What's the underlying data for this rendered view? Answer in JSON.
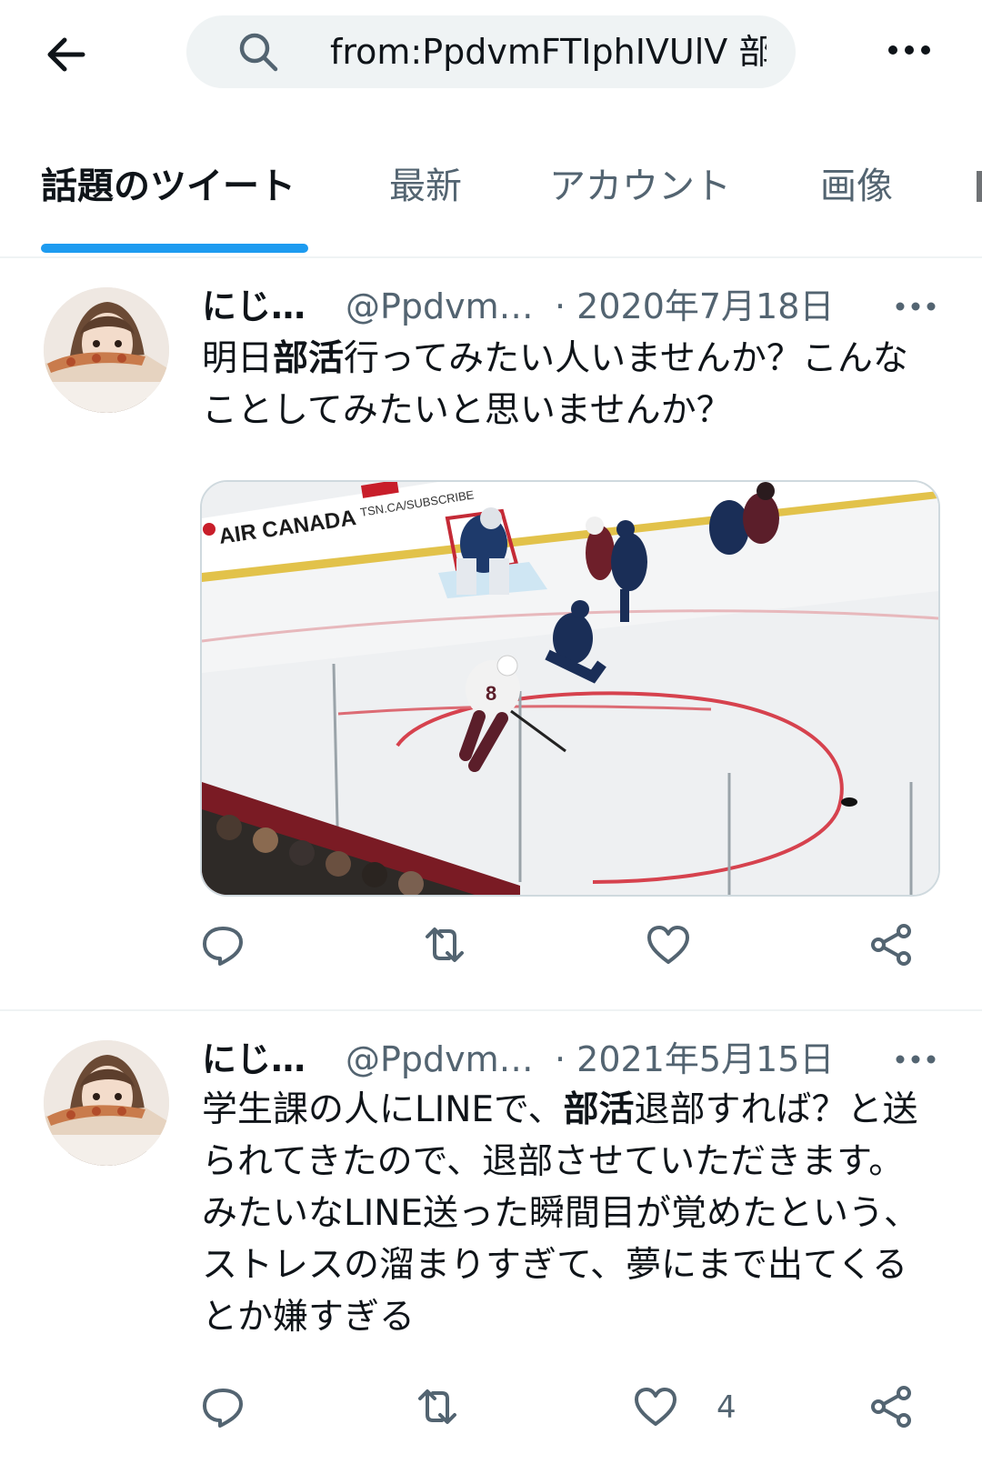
{
  "search": {
    "query": "from:PpdvmFTIphIVUlV 部"
  },
  "tabs": [
    {
      "label": "話題のツイート",
      "active": true
    },
    {
      "label": "最新",
      "active": false
    },
    {
      "label": "アカウント",
      "active": false
    },
    {
      "label": "画像",
      "active": false
    }
  ],
  "tweets": [
    {
      "name": "にじ…",
      "handle": "@Ppdvm…",
      "date": "· 2020年7月18日",
      "text_before": "明日",
      "text_bold": "部活",
      "text_after": "行ってみたい人いませんか？こんなことしてみたいと思いませんか？",
      "media": {
        "ad_text": "AIR CANADA",
        "board_text": "TSN.CA/SUBSCRIBE",
        "jersey_number": "8"
      },
      "like_count": ""
    },
    {
      "name": "にじ…",
      "handle": "@Ppdvm…",
      "date": "· 2021年5月15日",
      "text_before": "学生課の人にLINEで、",
      "text_bold": "部活",
      "text_after": "退部すれば？と送られてきたので、退部させていただきます。みたいなLINE送った瞬間目が覚めたという、ストレスの溜まりすぎて、夢にまで出てくるとか嫌すぎる",
      "like_count": "4"
    }
  ],
  "colors": {
    "accent": "#1d9bf0",
    "muted": "#536471",
    "text": "#0f1419"
  }
}
